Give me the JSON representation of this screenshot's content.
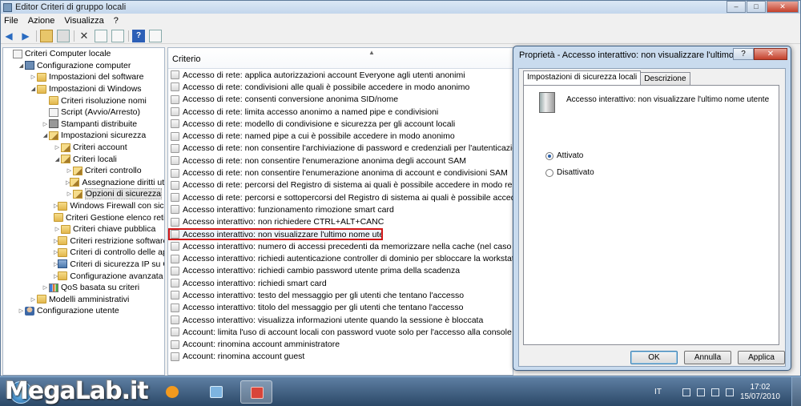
{
  "window": {
    "title": "Editor Criteri di gruppo locali",
    "controls": {
      "minimize": "–",
      "maximize": "□",
      "close": "✕"
    }
  },
  "menu": [
    "File",
    "Azione",
    "Visualizza",
    "?"
  ],
  "toolbar": {
    "icons": [
      "back-arrow-icon",
      "forward-arrow-icon",
      "up-folder-icon",
      "show-tree-icon",
      "delete-icon",
      "properties-icon",
      "export-icon",
      "help-icon",
      "filter-icon"
    ]
  },
  "tree": [
    {
      "label": "Criteri Computer locale",
      "icon": "doc",
      "indent": 0,
      "exp": ""
    },
    {
      "label": "Configurazione computer",
      "icon": "comp",
      "indent": 1,
      "exp": "◢"
    },
    {
      "label": "Impostazioni del software",
      "icon": "folder",
      "indent": 2,
      "exp": "▷"
    },
    {
      "label": "Impostazioni di Windows",
      "icon": "folder",
      "indent": 2,
      "exp": "◢"
    },
    {
      "label": "Criteri risoluzione nomi",
      "icon": "folder",
      "indent": 3,
      "exp": ""
    },
    {
      "label": "Script (Avvio/Arresto)",
      "icon": "doc",
      "indent": 3,
      "exp": ""
    },
    {
      "label": "Stampanti distribuite",
      "icon": "printer",
      "indent": 3,
      "exp": "▷"
    },
    {
      "label": "Impostazioni sicurezza",
      "icon": "lockfolder",
      "indent": 3,
      "exp": "◢"
    },
    {
      "label": "Criteri account",
      "icon": "lockfolder",
      "indent": 4,
      "exp": "▷"
    },
    {
      "label": "Criteri locali",
      "icon": "lockfolder",
      "indent": 4,
      "exp": "◢"
    },
    {
      "label": "Criteri controllo",
      "icon": "lockfolder",
      "indent": 5,
      "exp": "▷"
    },
    {
      "label": "Assegnazione diritti utent",
      "icon": "lockfolder",
      "indent": 5,
      "exp": "▷"
    },
    {
      "label": "Opzioni di sicurezza",
      "icon": "lockfolder",
      "indent": 5,
      "exp": "▷",
      "selected": true
    },
    {
      "label": "Windows Firewall con sicure",
      "icon": "folder",
      "indent": 4,
      "exp": "▷"
    },
    {
      "label": "Criteri Gestione elenco reti",
      "icon": "folder",
      "indent": 4,
      "exp": ""
    },
    {
      "label": "Criteri chiave pubblica",
      "icon": "folder",
      "indent": 4,
      "exp": "▷"
    },
    {
      "label": "Criteri restrizione software",
      "icon": "folder",
      "indent": 4,
      "exp": "▷"
    },
    {
      "label": "Criteri di controllo delle appl",
      "icon": "folder",
      "indent": 4,
      "exp": "▷"
    },
    {
      "label": "Criteri di sicurezza IP su Com",
      "icon": "netfolder",
      "indent": 4,
      "exp": "▷"
    },
    {
      "label": "Configurazione avanzata dei",
      "icon": "folder",
      "indent": 4,
      "exp": "▷"
    },
    {
      "label": "QoS basata su criteri",
      "icon": "chart",
      "indent": 3,
      "exp": "▷"
    },
    {
      "label": "Modelli amministrativi",
      "icon": "folder",
      "indent": 2,
      "exp": "▷"
    },
    {
      "label": "Configurazione utente",
      "icon": "user",
      "indent": 1,
      "exp": "▷"
    }
  ],
  "list": {
    "header": "Criterio",
    "rows": [
      "Accesso di rete: applica autorizzazioni account Everyone agli utenti anonimi",
      "Accesso di rete: condivisioni alle quali è possibile accedere in modo anonimo",
      "Accesso di rete: consenti conversione anonima SID/nome",
      "Accesso di rete: limita accesso anonimo a named pipe e condivisioni",
      "Accesso di rete: modello di condivisione e sicurezza per gli account locali",
      "Accesso di rete: named pipe a cui è possibile accedere in modo anonimo",
      "Accesso di rete: non consentire l'archiviazione di password e credenziali per l'autenticazione di rete",
      "Accesso di rete: non consentire l'enumerazione anonima degli account SAM",
      "Accesso di rete: non consentire l'enumerazione anonima di account e condivisioni SAM",
      "Accesso di rete: percorsi del Registro di sistema ai quali è possibile accedere in modo remoto",
      "Accesso di rete: percorsi e sottopercorsi del Registro di sistema ai quali è possibile accedere in modo",
      "Accesso interattivo: funzionamento rimozione smart card",
      "Accesso interattivo: non richiedere CTRL+ALT+CANC",
      "Accesso interattivo: non visualizzare l'ultimo nome utente",
      "Accesso interattivo: numero di accessi precedenti da memorizzare nella cache (nel caso in cui il co",
      "Accesso interattivo: richiedi autenticazione controller di dominio per sbloccare la workstation",
      "Accesso interattivo: richiedi cambio password utente prima della scadenza",
      "Accesso interattivo: richiedi smart card",
      "Accesso interattivo: testo del messaggio per gli utenti che tentano l'accesso",
      "Accesso interattivo: titolo del messaggio per gli utenti che tentano l'accesso",
      "Accesso interattivo: visualizza informazioni utente quando la sessione è bloccata",
      "Account: limita l'uso di account locali con password vuote solo per l'accesso alla console",
      "Account: rinomina account amministratore",
      "Account: rinomina account guest"
    ],
    "highlight_index": 13
  },
  "dialog": {
    "title": "Proprietà - Accesso interattivo: non visualizzare l'ultimo nome...",
    "help": "?",
    "close": "✕",
    "tabs": [
      "Impostazioni di sicurezza locali",
      "Descrizione"
    ],
    "policy_name": "Accesso interattivo: non visualizzare l'ultimo nome utente",
    "options": [
      {
        "label": "Attivato",
        "selected": true
      },
      {
        "label": "Disattivato",
        "selected": false
      }
    ],
    "buttons": {
      "ok": "OK",
      "cancel": "Annulla",
      "apply": "Applica"
    }
  },
  "taskbar": {
    "watermark": "MegaLab.it",
    "language": "IT",
    "time": "17:02",
    "date": "15/07/2010"
  },
  "colors": {
    "highlight_border": "#d01616",
    "accent": "#2a5fa8"
  }
}
